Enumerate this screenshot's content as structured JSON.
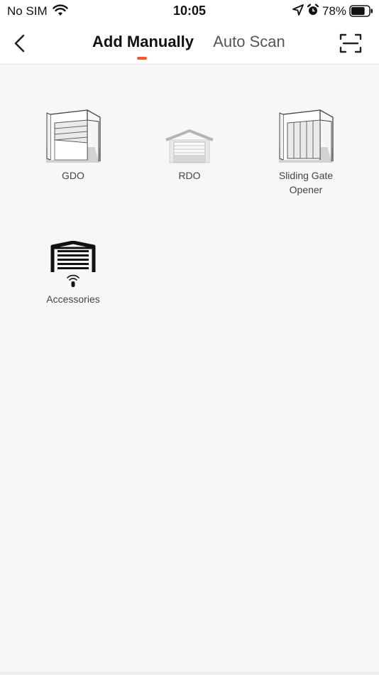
{
  "status_bar": {
    "carrier": "No SIM",
    "time": "10:05",
    "battery_percent": "78%",
    "battery_level": 0.78,
    "icons": [
      "wifi-icon",
      "location-arrow-icon",
      "alarm-icon",
      "battery-icon"
    ]
  },
  "nav": {
    "back_icon": "chevron-left-icon",
    "tabs": [
      {
        "label": "Add Manually",
        "active": true
      },
      {
        "label": "Auto Scan",
        "active": false
      }
    ],
    "scan_icon": "scan-frame-icon",
    "accent_color": "#ff5a1f"
  },
  "devices": [
    {
      "label": "GDO",
      "icon": "garage-door-opener-icon"
    },
    {
      "label": "RDO",
      "icon": "roller-door-opener-icon"
    },
    {
      "label": "Sliding Gate Opener",
      "icon": "sliding-gate-opener-icon"
    },
    {
      "label": "Accessories",
      "icon": "accessories-remote-icon"
    }
  ]
}
